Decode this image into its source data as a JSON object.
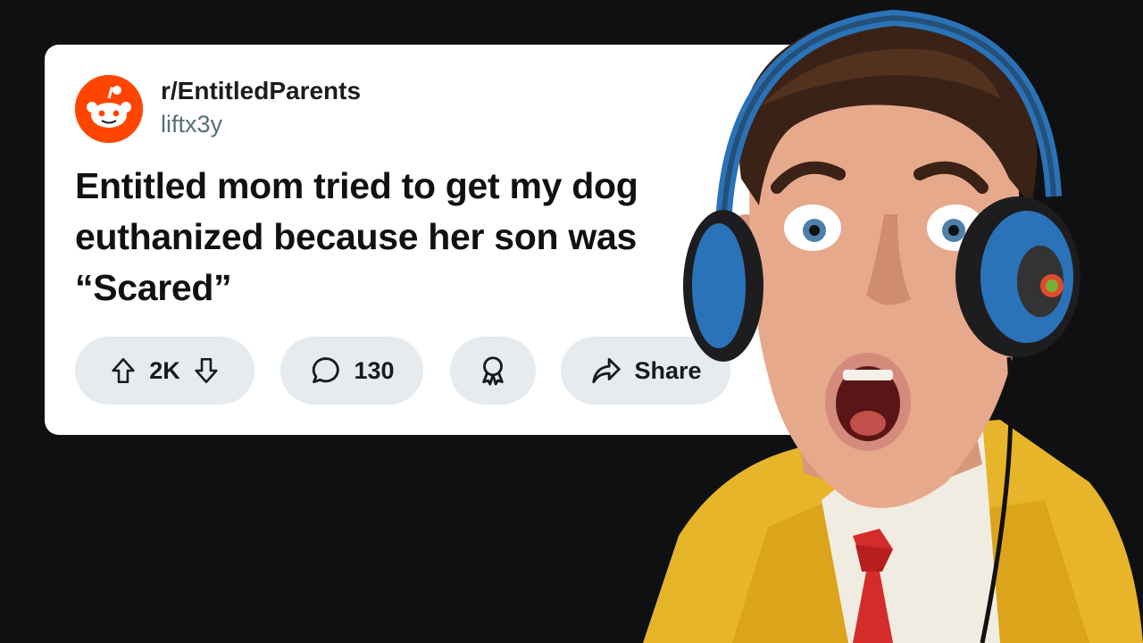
{
  "colors": {
    "brand": "#ff4500",
    "background": "#0f1012",
    "pill": "#e5ebee"
  },
  "post": {
    "subreddit": "r/EntitledParents",
    "username": "liftx3y",
    "title": "Entitled mom tried to get my dog euthanized because her son was “Scared”",
    "score": "2K",
    "comments": "130",
    "share_label": "Share"
  },
  "icons": {
    "avatar": "reddit-snoo-icon",
    "upvote": "arrow-up-icon",
    "downvote": "arrow-down-icon",
    "comment": "speech-bubble-icon",
    "award": "award-ribbon-icon",
    "share": "share-arrow-icon"
  }
}
